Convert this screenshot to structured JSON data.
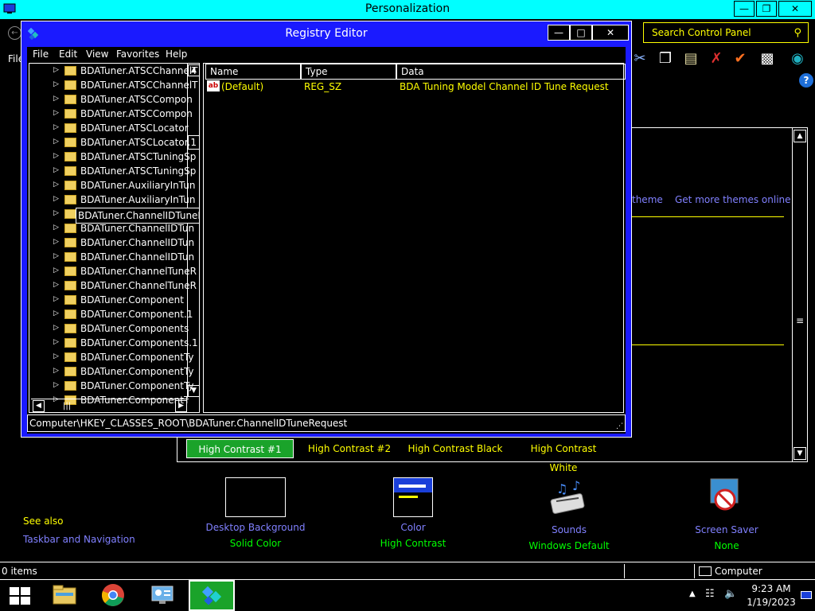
{
  "personalization": {
    "title": "Personalization",
    "file_menu": "File",
    "search": {
      "placeholder": "Search Control Panel"
    },
    "theme_links": [
      "theme",
      "Get more themes online"
    ],
    "high_contrast_tabs": [
      "High Contrast #1",
      "High Contrast #2",
      "High Contrast Black",
      "High Contrast White"
    ],
    "bottom_items": [
      {
        "label": "Desktop Background",
        "value": "Solid Color"
      },
      {
        "label": "Color",
        "value": "High Contrast"
      },
      {
        "label": "Sounds",
        "value": "Windows Default"
      },
      {
        "label": "Screen Saver",
        "value": "None"
      }
    ],
    "see_also": "See also",
    "taskbar_navigation": "Taskbar and Navigation",
    "status": {
      "items": "0 items",
      "location": "Computer"
    }
  },
  "regedit": {
    "title": "Registry Editor",
    "menu": [
      "File",
      "Edit",
      "View",
      "Favorites",
      "Help"
    ],
    "tree_items": [
      "BDATuner.ATSCChannelT",
      "BDATuner.ATSCChannelT",
      "BDATuner.ATSCCompon",
      "BDATuner.ATSCCompon",
      "BDATuner.ATSCLocator",
      "BDATuner.ATSCLocator.1",
      "BDATuner.ATSCTuningSp",
      "BDATuner.ATSCTuningSp",
      "BDATuner.AuxiliaryInTun",
      "BDATuner.AuxiliaryInTun",
      "BDATuner.ChannelIDTuneRequest",
      "BDATuner.ChannelIDTun",
      "BDATuner.ChannelIDTun",
      "BDATuner.ChannelIDTun",
      "BDATuner.ChannelTuneR",
      "BDATuner.ChannelTuneR",
      "BDATuner.Component",
      "BDATuner.Component.1",
      "BDATuner.Components",
      "BDATuner.Components.1",
      "BDATuner.ComponentTy",
      "BDATuner.ComponentTy",
      "BDATuner.ComponentTy",
      "BDATuner.ComponentT"
    ],
    "selected_key": "BDATuner.ChannelIDTuneRequest",
    "columns": {
      "name": "Name",
      "type": "Type",
      "data": "Data"
    },
    "values": [
      {
        "name": "(Default)",
        "type": "REG_SZ",
        "data": "BDA Tuning Model Channel ID Tune Request"
      }
    ],
    "status_path": "Computer\\HKEY_CLASSES_ROOT\\BDATuner.ChannelIDTuneRequest"
  },
  "taskbar": {
    "clock_time": "9:23 AM",
    "clock_date": "1/19/2023",
    "pinned": [
      "file-explorer",
      "chrome",
      "control-panel",
      "registry-editor"
    ],
    "active": "registry-editor"
  },
  "colors": {
    "regedit_frame": "#1a1aff",
    "link": "#8080ff",
    "highlight_yellow": "#ffff00",
    "value_green": "#00ff00",
    "active_tab": "#1aa32a",
    "titlebar_cyan": "#00ffff"
  }
}
